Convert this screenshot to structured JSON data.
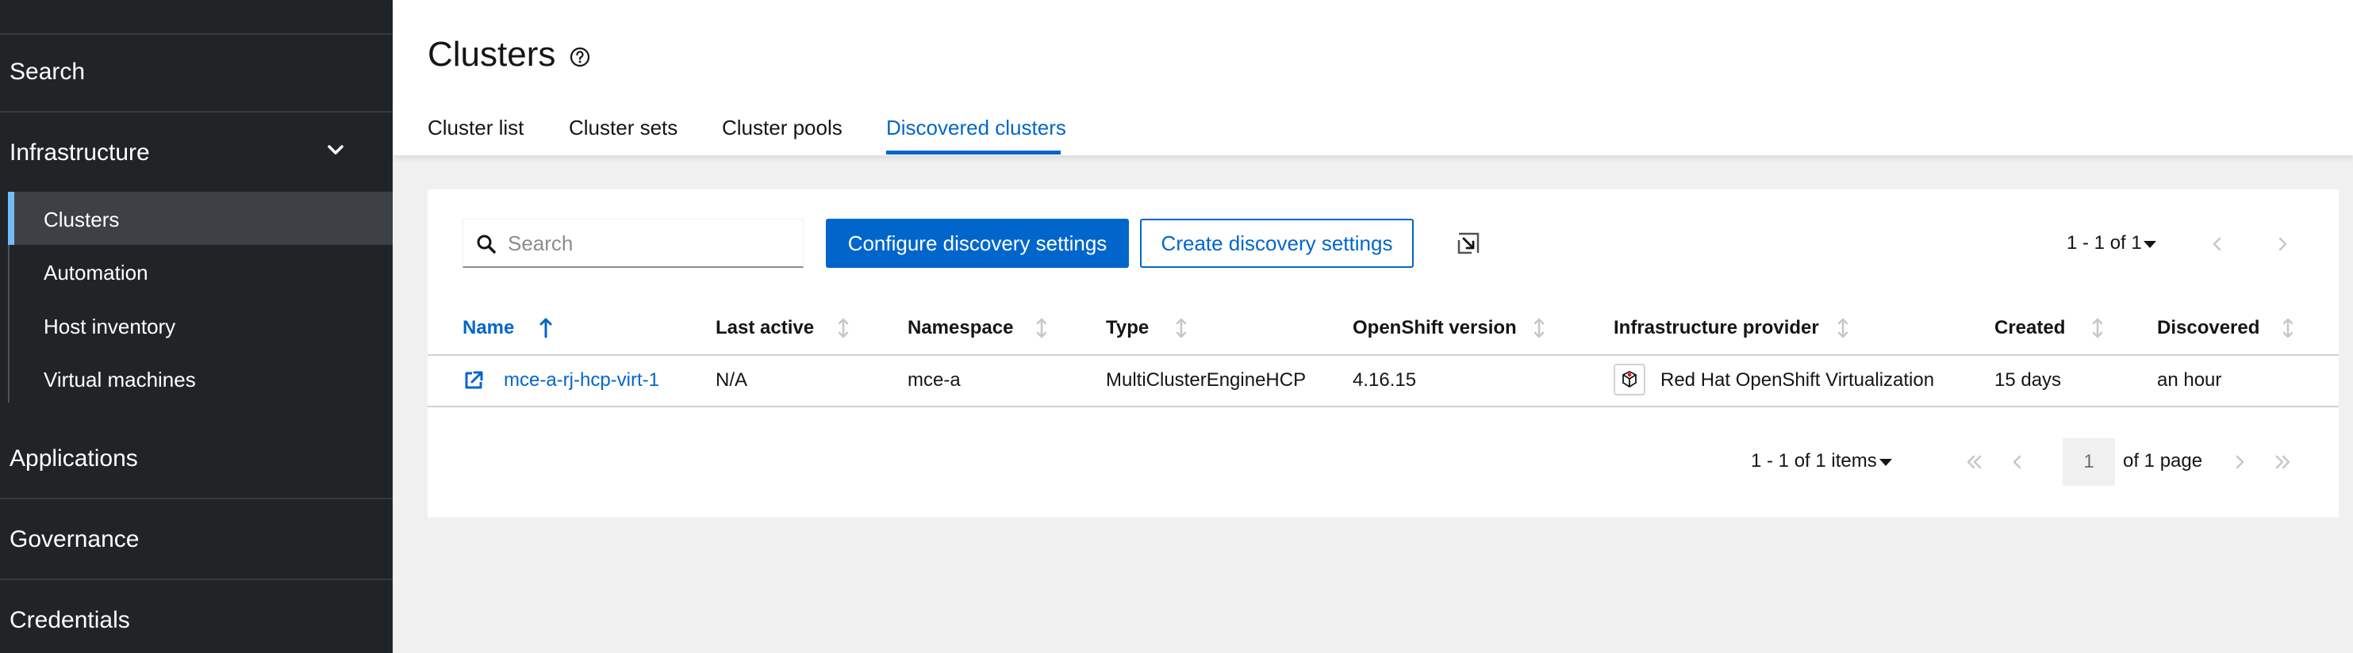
{
  "sidebar": {
    "groups": [
      {
        "label": "Search"
      },
      {
        "label": "Infrastructure"
      },
      {
        "label": "Applications"
      },
      {
        "label": "Governance"
      },
      {
        "label": "Credentials"
      }
    ],
    "infrastructure_items": [
      {
        "label": "Clusters",
        "active": true
      },
      {
        "label": "Automation"
      },
      {
        "label": "Host inventory"
      },
      {
        "label": "Virtual machines"
      }
    ],
    "active_accent": "#73bcf7"
  },
  "header": {
    "title": "Clusters",
    "tabs": [
      {
        "label": "Cluster list"
      },
      {
        "label": "Cluster sets"
      },
      {
        "label": "Cluster pools"
      },
      {
        "label": "Discovered clusters",
        "active": true
      }
    ]
  },
  "toolbar": {
    "search_placeholder": "Search",
    "search_value": "",
    "configure_label": "Configure discovery settings",
    "create_label": "Create discovery settings",
    "pagination": "1 - 1 of 1"
  },
  "table": {
    "columns": [
      "Name",
      "Last active",
      "Namespace",
      "Type",
      "OpenShift version",
      "Infrastructure provider",
      "Created",
      "Discovered"
    ],
    "sorted_column": "Name",
    "rows": [
      {
        "name": "mce-a-rj-hcp-virt-1",
        "last_active": "N/A",
        "namespace": "mce-a",
        "type": "MultiClusterEngineHCP",
        "version": "4.16.15",
        "provider": "Red Hat OpenShift Virtualization",
        "created": "15 days",
        "discovered": "an hour"
      }
    ]
  },
  "footer": {
    "items_label": "1 - 1 of 1 items",
    "page_value": "1",
    "of_pages": "of 1 page"
  },
  "colors": {
    "primary": "#0066cc",
    "sidebar_bg": "#212427"
  }
}
